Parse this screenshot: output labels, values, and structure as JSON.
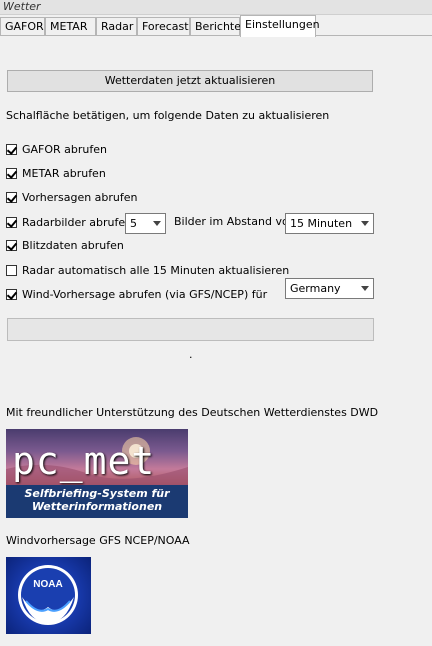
{
  "window": {
    "title": "Wetter"
  },
  "tabs": [
    {
      "label": "GAFOR"
    },
    {
      "label": "METAR"
    },
    {
      "label": "Radar"
    },
    {
      "label": "Forecast"
    },
    {
      "label": "Berichte"
    },
    {
      "label": "Einstellungen",
      "active": true
    }
  ],
  "settings": {
    "update_button": "Wetterdaten jetzt aktualisieren",
    "instruction": "Schalfläche betätigen, um folgende Daten zu aktualisieren",
    "options": [
      {
        "label": "GAFOR abrufen",
        "checked": true
      },
      {
        "label": "METAR abrufen",
        "checked": true
      },
      {
        "label": "Vorhersagen abrufen",
        "checked": true
      },
      {
        "label": "Radarbilder abrufen",
        "checked": true
      },
      {
        "label": "Blitzdaten abrufen",
        "checked": true
      },
      {
        "label": "Radar automatisch alle 15 Minuten aktualisieren",
        "checked": false
      },
      {
        "label": "Wind-Vorhersage abrufen (via GFS/NCEP) für",
        "checked": true
      }
    ],
    "radar_count": "5",
    "interval_label": "Bilder im Abstand von",
    "interval_value": "15 Minuten",
    "region_value": "Germany",
    "status_dot": "."
  },
  "credits": {
    "dwd_text": "Mit freundlicher Unterstützung des Deutschen Wetterdienstes DWD",
    "pcmet_logo_text": "pc_met",
    "pcmet_tagline": "Selfbriefing-System für Wetterinformationen",
    "gfs_text": "Windvorhersage GFS  NCEP/NOAA",
    "noaa_logo_text": "NOAA"
  }
}
